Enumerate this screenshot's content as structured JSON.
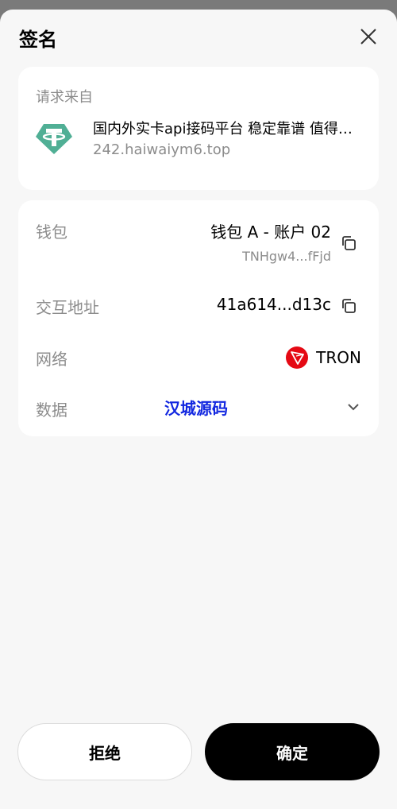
{
  "header": {
    "title": "签名"
  },
  "source": {
    "label": "请求来自",
    "name": "国内外实卡api接码平台 稳定靠谱 值得信赖",
    "url": "242.haiwaiym6.top"
  },
  "details": {
    "wallet_label": "钱包",
    "wallet_value": "钱包 A - 账户 02",
    "wallet_address": "TNHgw4...fFjd",
    "interact_label": "交互地址",
    "interact_value": "41a614...d13c",
    "network_label": "网络",
    "network_value": "TRON",
    "data_label": "数据",
    "watermark": "汉城源码"
  },
  "actions": {
    "reject": "拒绝",
    "confirm": "确定"
  },
  "colors": {
    "accent": "#000000",
    "tron_red": "#e50914",
    "tether_green": "#50af95"
  }
}
